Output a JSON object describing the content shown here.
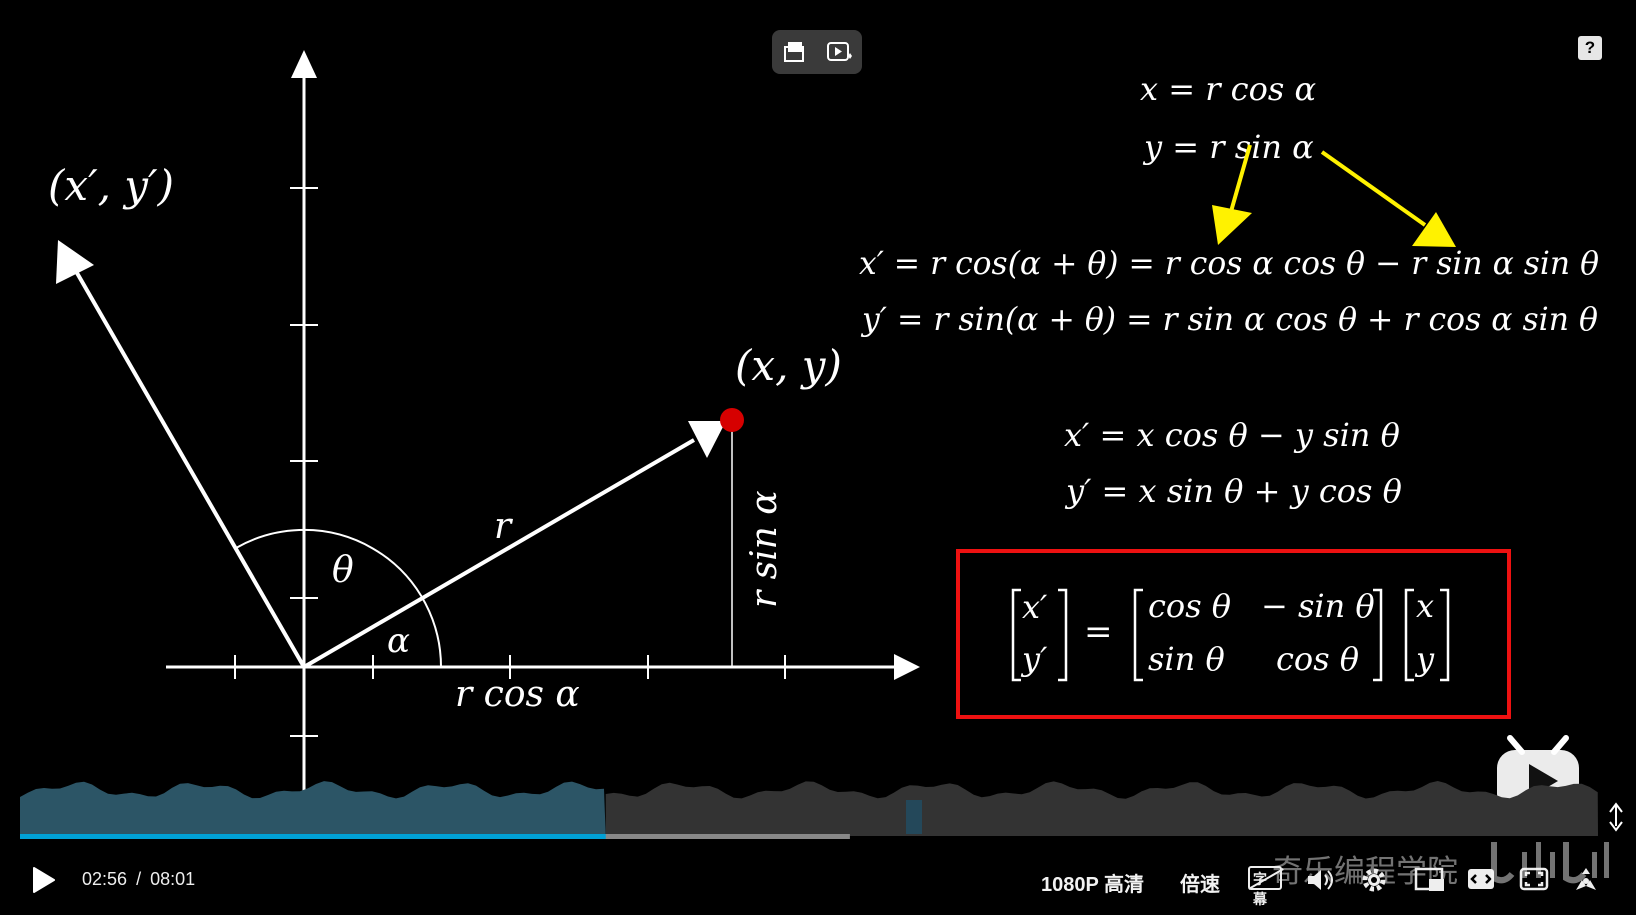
{
  "window": {
    "top_buttons": [
      {
        "name": "screen-cast-icon"
      },
      {
        "name": "ai-video-icon"
      }
    ],
    "help_label": "?"
  },
  "graph": {
    "point_label": "(x, y)",
    "rotated_point_label": "(x′, y′)",
    "r_label": "r",
    "theta_label": "θ",
    "alpha_label": "α",
    "rcos_label": "r cos α",
    "rsin_label": "r sin α"
  },
  "equations": {
    "eq1": "x = r cos α",
    "eq2": "y = r sin α",
    "eq3": "x′ = r cos(α + θ) = r cos α cos θ − r sin α sin θ",
    "eq4": "y′ = r sin(α + θ) = r sin α cos θ + r cos α sin θ",
    "eq5": "x′ = x cos θ − y sin θ",
    "eq6": "y′ = x sin θ + y cos θ"
  },
  "matrix": {
    "lhs": [
      "x′",
      "y′"
    ],
    "equals": "=",
    "rot": [
      "cos θ",
      "− sin θ",
      "sin θ",
      "cos θ"
    ],
    "rhs": [
      "x",
      "y"
    ]
  },
  "player": {
    "current_time": "02:56",
    "separator": "/",
    "total_time": "08:01",
    "progress_fraction": 0.367,
    "buffered_fraction": 0.52,
    "quality_label": "1080P 高清",
    "speed_label": "倍速",
    "subtitle_label": "字幕",
    "watermark": "奇乐编程学院",
    "brand": "bilibili",
    "accent_color": "#00a1d6"
  }
}
